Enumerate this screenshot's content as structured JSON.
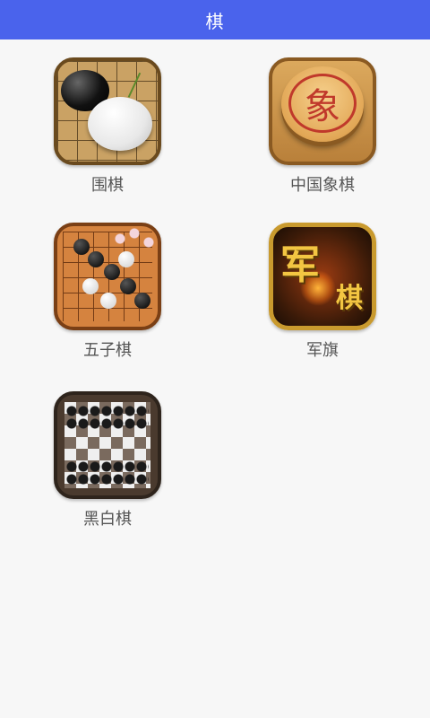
{
  "header": {
    "title": "棋"
  },
  "games": [
    {
      "label": "围棋"
    },
    {
      "label": "中国象棋",
      "icon_char": "象"
    },
    {
      "label": "五子棋"
    },
    {
      "label": "军旗",
      "icon_big": "军",
      "icon_small": "棋"
    },
    {
      "label": "黑白棋"
    }
  ],
  "colors": {
    "header_bg": "#4a63ec",
    "header_text": "#ffffff",
    "page_bg": "#f7f7f7",
    "label_text": "#555555"
  }
}
